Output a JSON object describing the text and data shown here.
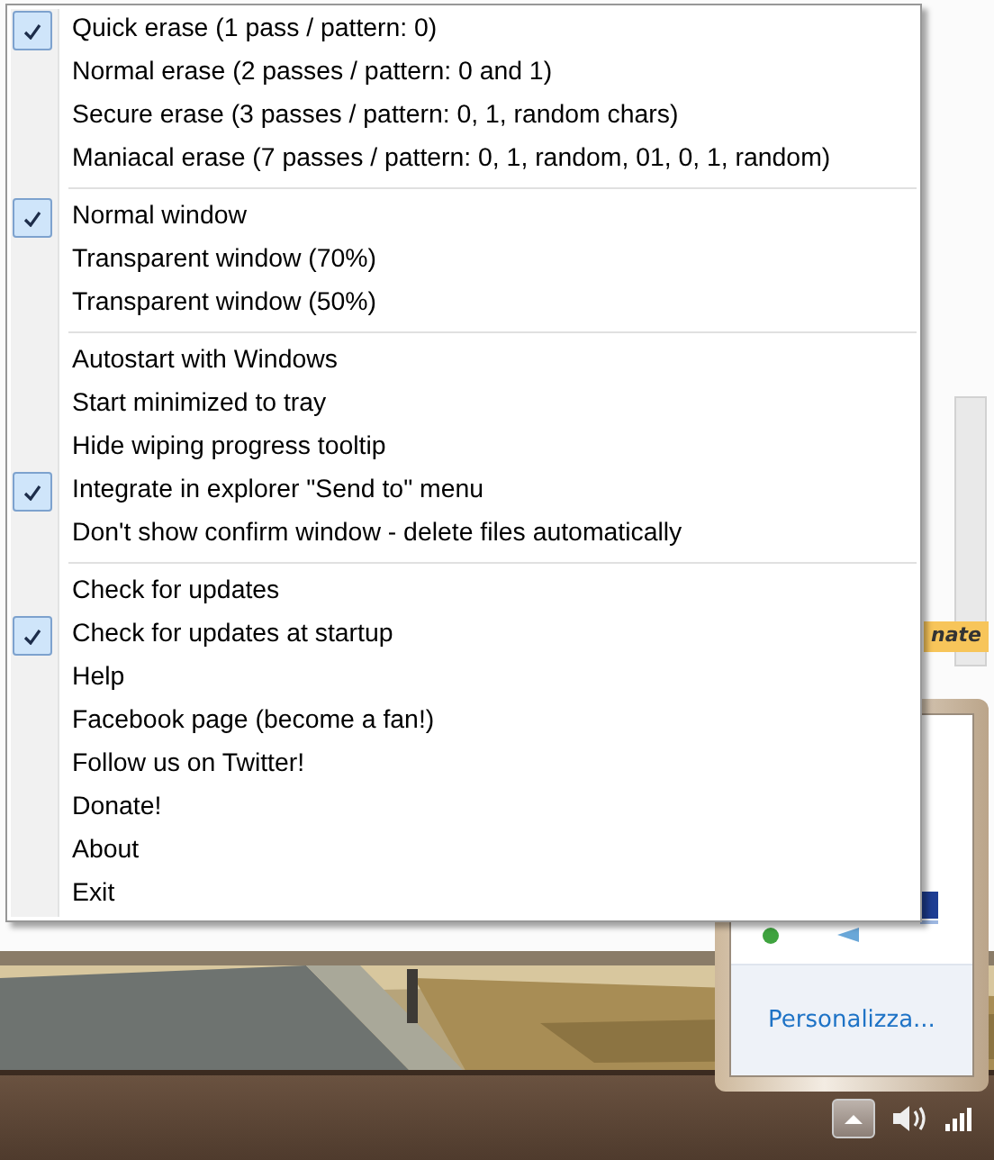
{
  "background_window": {
    "fragments": [
      {
        "text": "nate"
      }
    ]
  },
  "menu": {
    "groups": [
      {
        "items": [
          {
            "label": "Quick erase (1 pass / pattern: 0)",
            "checked": true
          },
          {
            "label": "Normal erase (2 passes / pattern: 0 and 1)",
            "checked": false
          },
          {
            "label": "Secure erase (3 passes / pattern: 0, 1, random chars)",
            "checked": false
          },
          {
            "label": "Maniacal erase (7 passes / pattern: 0, 1, random, 01, 0, 1, random)",
            "checked": false
          }
        ]
      },
      {
        "items": [
          {
            "label": "Normal window",
            "checked": true
          },
          {
            "label": "Transparent window (70%)",
            "checked": false
          },
          {
            "label": "Transparent window (50%)",
            "checked": false
          }
        ]
      },
      {
        "items": [
          {
            "label": "Autostart with Windows",
            "checked": false
          },
          {
            "label": "Start minimized to tray",
            "checked": false
          },
          {
            "label": "Hide wiping progress tooltip",
            "checked": false
          },
          {
            "label": "Integrate in explorer \"Send to\" menu",
            "checked": true
          },
          {
            "label": "Don't show confirm window - delete files automatically",
            "checked": false
          }
        ]
      },
      {
        "items": [
          {
            "label": "Check for updates",
            "checked": false
          },
          {
            "label": "Check for updates at startup",
            "checked": true
          },
          {
            "label": "Help",
            "checked": false
          },
          {
            "label": "Facebook page (become a fan!)",
            "checked": false
          },
          {
            "label": "Follow us on Twitter!",
            "checked": false
          },
          {
            "label": "Donate!",
            "checked": false
          },
          {
            "label": "About",
            "checked": false
          },
          {
            "label": "Exit",
            "checked": false
          }
        ]
      }
    ]
  },
  "tray_popup": {
    "link": "Personalizza..."
  }
}
